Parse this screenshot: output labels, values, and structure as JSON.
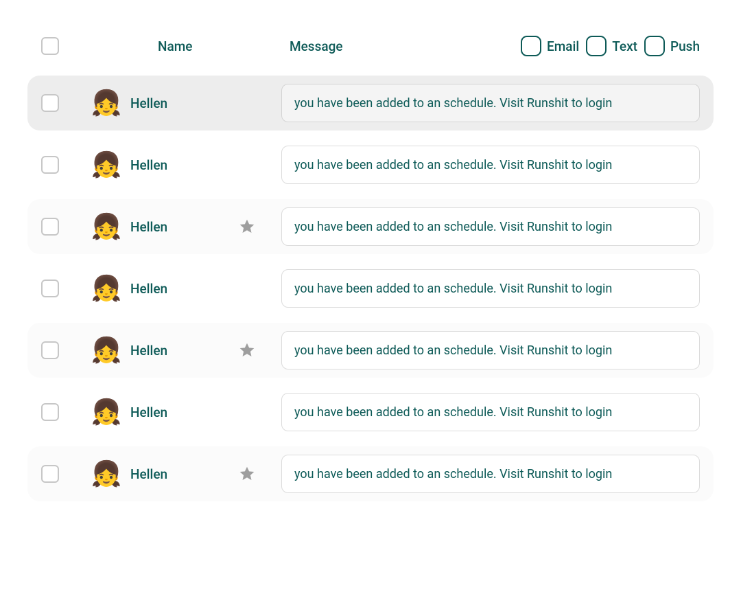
{
  "header": {
    "name_label": "Name",
    "message_label": "Message",
    "options": [
      {
        "label": "Email"
      },
      {
        "label": "Text"
      },
      {
        "label": "Push"
      }
    ]
  },
  "avatar_emoji": "👧",
  "rows": [
    {
      "name": "Hellen",
      "message": "you have been added to an schedule. Visit Runshit to login",
      "variant": "selected",
      "starred": false
    },
    {
      "name": "Hellen",
      "message": "you have been added to an schedule. Visit Runshit to login",
      "variant": "plain",
      "starred": false
    },
    {
      "name": "Hellen",
      "message": "you have been added to an schedule. Visit Runshit to login",
      "variant": "light",
      "starred": true
    },
    {
      "name": "Hellen",
      "message": "you have been added to an schedule. Visit Runshit to login",
      "variant": "plain",
      "starred": false
    },
    {
      "name": "Hellen",
      "message": "you have been added to an schedule. Visit Runshit to login",
      "variant": "light",
      "starred": true
    },
    {
      "name": "Hellen",
      "message": "you have been added to an schedule. Visit Runshit to login",
      "variant": "plain",
      "starred": false
    },
    {
      "name": "Hellen",
      "message": "you have been added to an schedule. Visit Runshit to login",
      "variant": "light",
      "starred": true
    }
  ]
}
